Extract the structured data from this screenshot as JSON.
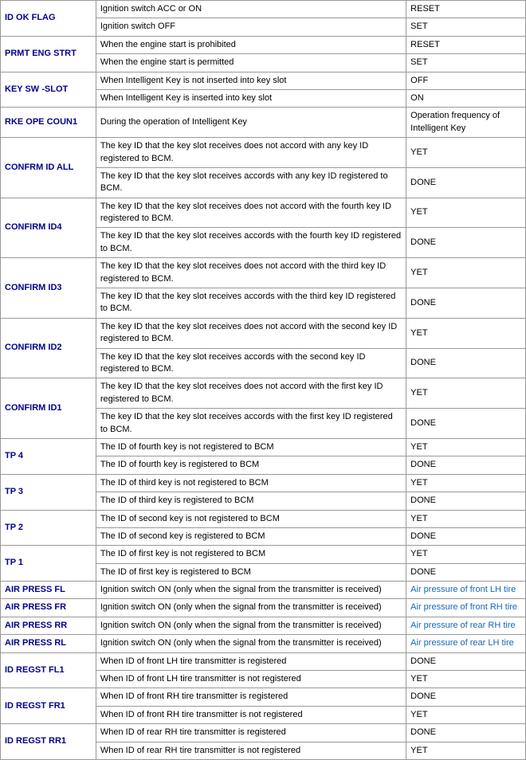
{
  "table": {
    "rows": [
      {
        "id": "ID OK FLAG",
        "desc": "Ignition switch ACC or ON",
        "value": "RESET",
        "value_blue": false
      },
      {
        "id": "",
        "desc": "Ignition switch OFF",
        "value": "SET",
        "value_blue": false
      },
      {
        "id": "PRMT ENG STRT",
        "desc": "When the engine start is prohibited",
        "value": "RESET",
        "value_blue": false
      },
      {
        "id": "",
        "desc": "When the engine start is permitted",
        "value": "SET",
        "value_blue": false
      },
      {
        "id": "KEY SW -SLOT",
        "desc": "When Intelligent Key is not inserted into key slot",
        "value": "OFF",
        "value_blue": false
      },
      {
        "id": "",
        "desc": "When Intelligent Key is inserted into key slot",
        "value": "ON",
        "value_blue": false
      },
      {
        "id": "RKE OPE COUN1",
        "desc": "During the operation of Intelligent Key",
        "value": "Operation frequency of Intelligent Key",
        "value_blue": false
      },
      {
        "id": "CONFRM ID ALL",
        "desc": "The key ID that the key slot receives does not accord with any key ID registered to BCM.",
        "value": "YET",
        "value_blue": false
      },
      {
        "id": "",
        "desc": "The key ID that the key slot receives accords with any key ID registered to BCM.",
        "value": "DONE",
        "value_blue": false
      },
      {
        "id": "CONFIRM ID4",
        "desc": "The key ID that the key slot receives does not accord with the fourth key ID registered to BCM.",
        "value": "YET",
        "value_blue": false
      },
      {
        "id": "",
        "desc": "The key ID that the key slot receives accords with the fourth key ID registered to BCM.",
        "value": "DONE",
        "value_blue": false
      },
      {
        "id": "CONFIRM ID3",
        "desc": "The key ID that the key slot receives does not accord with the third key ID registered to BCM.",
        "value": "YET",
        "value_blue": false
      },
      {
        "id": "",
        "desc": "The key ID that the key slot receives accords with the third key ID registered to BCM.",
        "value": "DONE",
        "value_blue": false
      },
      {
        "id": "CONFIRM ID2",
        "desc": "The key ID that the key slot receives does not accord with the second key ID registered to BCM.",
        "value": "YET",
        "value_blue": false
      },
      {
        "id": "",
        "desc": "The key ID that the key slot receives accords with the second key ID registered to BCM.",
        "value": "DONE",
        "value_blue": false
      },
      {
        "id": "CONFIRM ID1",
        "desc": "The key ID that the key slot receives does not accord with the first key ID registered to BCM.",
        "value": "YET",
        "value_blue": false
      },
      {
        "id": "",
        "desc": "The key ID that the key slot receives accords with the first key ID registered to BCM.",
        "value": "DONE",
        "value_blue": false
      },
      {
        "id": "TP 4",
        "desc": "The ID of fourth key is not registered to BCM",
        "value": "YET",
        "value_blue": false
      },
      {
        "id": "",
        "desc": "The ID of fourth key is registered to BCM",
        "value": "DONE",
        "value_blue": false
      },
      {
        "id": "TP 3",
        "desc": "The ID of third key is not registered to BCM",
        "value": "YET",
        "value_blue": false
      },
      {
        "id": "",
        "desc": "The ID of third key is registered to BCM",
        "value": "DONE",
        "value_blue": false
      },
      {
        "id": "TP 2",
        "desc": "The ID of second key is not registered to BCM",
        "value": "YET",
        "value_blue": false
      },
      {
        "id": "",
        "desc": "The ID of second key is registered to BCM",
        "value": "DONE",
        "value_blue": false
      },
      {
        "id": "TP 1",
        "desc": "The ID of first key is not registered to BCM",
        "value": "YET",
        "value_blue": false
      },
      {
        "id": "",
        "desc": "The ID of first key is registered to BCM",
        "value": "DONE",
        "value_blue": false
      },
      {
        "id": "AIR PRESS FL",
        "desc": "Ignition switch ON (only when the signal from the transmitter is received)",
        "value": "Air pressure of front LH tire",
        "value_blue": true
      },
      {
        "id": "AIR PRESS FR",
        "desc": "Ignition switch ON (only when the signal from the transmitter is received)",
        "value": "Air pressure of front RH tire",
        "value_blue": true
      },
      {
        "id": "AIR PRESS RR",
        "desc": "Ignition switch ON (only when the signal from the transmitter is received)",
        "value": "Air pressure of rear RH tire",
        "value_blue": true
      },
      {
        "id": "AIR PRESS RL",
        "desc": "Ignition switch ON (only when the signal from the transmitter is received)",
        "value": "Air pressure of rear LH tire",
        "value_blue": true
      },
      {
        "id": "ID REGST FL1",
        "desc": "When ID of front LH tire transmitter is registered",
        "value": "DONE",
        "value_blue": false
      },
      {
        "id": "",
        "desc": "When ID of front LH tire transmitter is not registered",
        "value": "YET",
        "value_blue": false
      },
      {
        "id": "ID REGST FR1",
        "desc": "When ID of front RH tire transmitter is registered",
        "value": "DONE",
        "value_blue": false
      },
      {
        "id": "",
        "desc": "When ID of front RH tire transmitter is not registered",
        "value": "YET",
        "value_blue": false
      },
      {
        "id": "ID REGST RR1",
        "desc": "When ID of rear RH tire transmitter is registered",
        "value": "DONE",
        "value_blue": false
      },
      {
        "id": "",
        "desc": "When ID of rear RH tire transmitter is not registered",
        "value": "YET",
        "value_blue": false
      }
    ]
  }
}
